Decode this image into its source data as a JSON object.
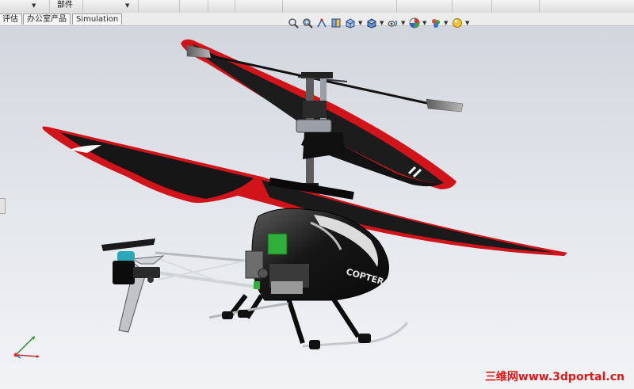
{
  "ribbon": {
    "group_label": "部件"
  },
  "tabs": [
    {
      "label": "评估"
    },
    {
      "label": "办公室产品"
    },
    {
      "label": "Simulation"
    }
  ],
  "view_toolbar": {
    "icons": [
      "zoom-to-fit-icon",
      "zoom-area-icon",
      "previous-view-icon",
      "section-view-icon",
      "view-orientation-icon",
      "display-style-icon",
      "hide-show-icon",
      "edit-appearance-icon",
      "apply-scene-icon",
      "view-settings-icon"
    ]
  },
  "model": {
    "decal_text": "COPTER"
  },
  "watermark": {
    "text": "三维网www.3dportal.cn"
  },
  "colors": {
    "viewport_top": "#cfd4dc",
    "viewport_bottom": "#f2f3f5",
    "blade_red": "#d0141a",
    "blade_black": "#151515",
    "watermark_red": "#e01818"
  }
}
